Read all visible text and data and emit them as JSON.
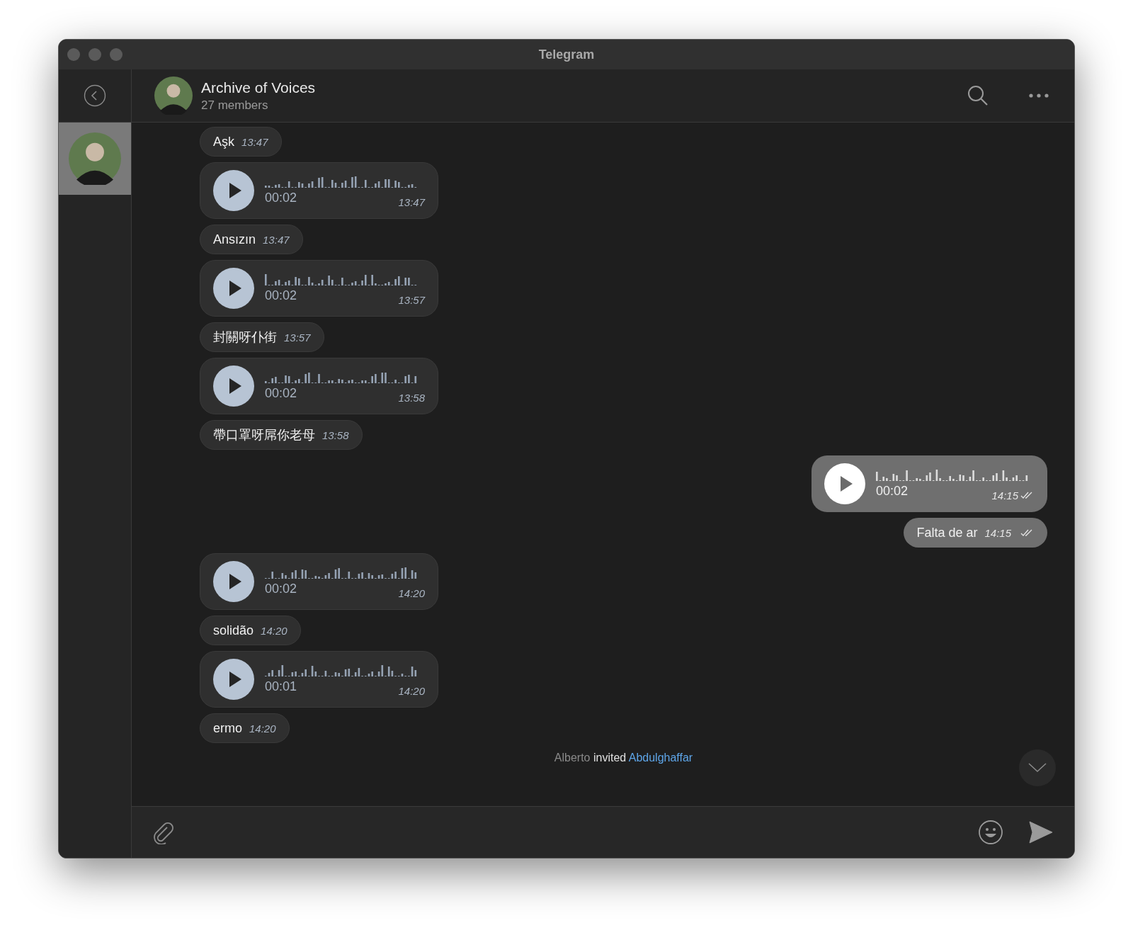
{
  "window": {
    "title": "Telegram"
  },
  "sidebar": {
    "chats": [
      {
        "selected": true
      }
    ]
  },
  "header": {
    "title": "Archive of Voices",
    "subtitle": "27 members"
  },
  "messages": [
    {
      "kind": "text",
      "outgoing": false,
      "text": "Aşk",
      "time": "13:47"
    },
    {
      "kind": "voice",
      "outgoing": false,
      "duration": "00:02",
      "time": "13:47"
    },
    {
      "kind": "text",
      "outgoing": false,
      "text": "Ansızın",
      "time": "13:47"
    },
    {
      "kind": "voice",
      "outgoing": false,
      "duration": "00:02",
      "time": "13:57"
    },
    {
      "kind": "text",
      "outgoing": false,
      "text": "封關呀仆街",
      "time": "13:57"
    },
    {
      "kind": "voice",
      "outgoing": false,
      "duration": "00:02",
      "time": "13:58"
    },
    {
      "kind": "text",
      "outgoing": false,
      "text": "帶口罩呀屌你老母",
      "time": "13:58"
    },
    {
      "kind": "voice",
      "outgoing": true,
      "duration": "00:02",
      "time": "14:15",
      "read": true
    },
    {
      "kind": "text",
      "outgoing": true,
      "text": "Falta de ar",
      "time": "14:15",
      "read": true
    },
    {
      "kind": "voice",
      "outgoing": false,
      "duration": "00:02",
      "time": "14:20"
    },
    {
      "kind": "text",
      "outgoing": false,
      "text": "solidão",
      "time": "14:20"
    },
    {
      "kind": "voice",
      "outgoing": false,
      "duration": "00:01",
      "time": "14:20"
    },
    {
      "kind": "text",
      "outgoing": false,
      "text": "ermo",
      "time": "14:20"
    }
  ],
  "service_message": {
    "actor": "Alberto",
    "action": "invited",
    "target": "Abdulghaffar"
  }
}
